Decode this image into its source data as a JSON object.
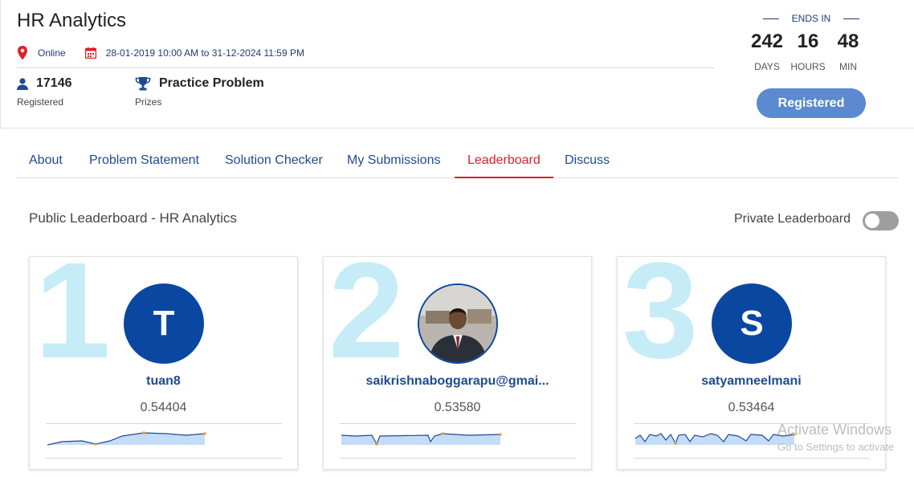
{
  "header": {
    "title": "HR Analytics",
    "location": "Online",
    "date_range": "28-01-2019 10:00 AM to 31-12-2024 11:59 PM",
    "registered_count": "17146",
    "registered_label": "Registered",
    "prize_value": "Practice Problem",
    "prize_label": "Prizes"
  },
  "countdown": {
    "label": "ENDS IN",
    "days": "242",
    "days_label": "DAYS",
    "hours": "16",
    "hours_label": "HOURS",
    "min": "48",
    "min_label": "MIN"
  },
  "register_button": "Registered",
  "tabs": [
    {
      "label": "About"
    },
    {
      "label": "Problem Statement"
    },
    {
      "label": "Solution Checker"
    },
    {
      "label": "My Submissions"
    },
    {
      "label": "Leaderboard",
      "active": true
    },
    {
      "label": "Discuss"
    }
  ],
  "leaderboard": {
    "title": "Public Leaderboard - HR Analytics",
    "private_label": "Private Leaderboard",
    "private_enabled": false,
    "entries": [
      {
        "rank": "1",
        "initial": "T",
        "name": "tuan8",
        "score": "0.54404"
      },
      {
        "rank": "2",
        "initial": "",
        "name": "saikrishnaboggarapu@gmai...",
        "score": "0.53580"
      },
      {
        "rank": "3",
        "initial": "S",
        "name": "satyamneelmani",
        "score": "0.53464"
      }
    ]
  },
  "colors": {
    "primary_blue": "#0a47a0",
    "link_blue": "#1f4a93",
    "active_red": "#d92126",
    "button_blue": "#5b8ad0",
    "rank_numeral": "#c6ecf7"
  },
  "watermark": {
    "line1": "Activate Windows",
    "line2": "Go to Settings to activate"
  }
}
